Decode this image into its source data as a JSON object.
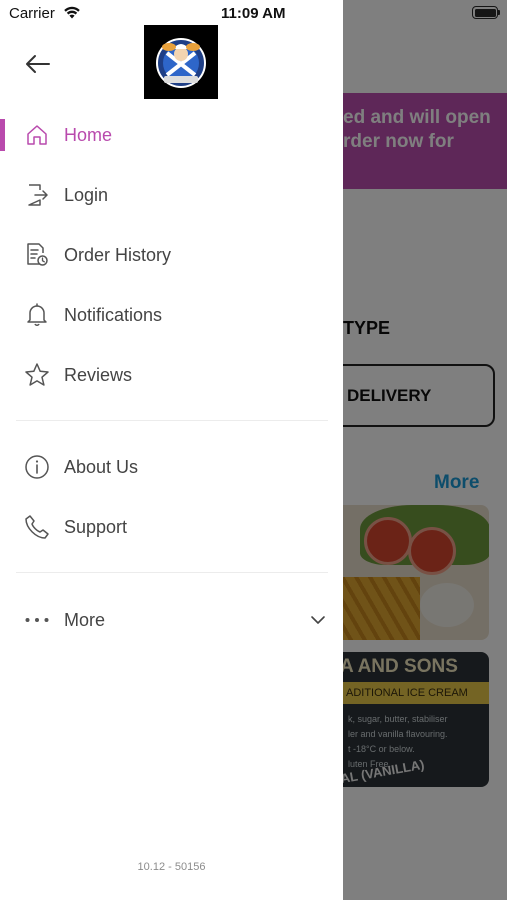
{
  "status_bar": {
    "carrier": "Carrier",
    "time": "11:09 AM"
  },
  "background": {
    "banner_line1": "ed and will open",
    "banner_line2": "rder now for",
    "section_type": "TYPE",
    "delivery_label": "DELIVERY",
    "more_link": "More",
    "card2_title": "A AND SONS",
    "card2_band": "ADITIONAL ICE CREAM",
    "card2_small_1": "k, sugar, butter, stabiliser",
    "card2_small_2": "ler and vanilla flavouring.",
    "card2_small_3": "t -18°C or below.",
    "card2_small_4": "luten Free.",
    "card2_bottom": "AL (VANILLA)"
  },
  "drawer": {
    "menu": [
      {
        "label": "Home",
        "icon": "home-icon",
        "active": true
      },
      {
        "label": "Login",
        "icon": "login-icon",
        "active": false
      },
      {
        "label": "Order History",
        "icon": "order-history-icon",
        "active": false
      },
      {
        "label": "Notifications",
        "icon": "bell-icon",
        "active": false
      },
      {
        "label": "Reviews",
        "icon": "star-icon",
        "active": false
      }
    ],
    "secondary": [
      {
        "label": "About Us",
        "icon": "info-icon"
      },
      {
        "label": "Support",
        "icon": "phone-icon"
      }
    ],
    "more": {
      "label": "More",
      "icon": "more-dots-icon"
    },
    "version": "10.12 - 50156"
  },
  "colors": {
    "accent": "#b94aad",
    "banner": "#bd4fb1",
    "link": "#1a9ad6",
    "text": "#444444"
  }
}
